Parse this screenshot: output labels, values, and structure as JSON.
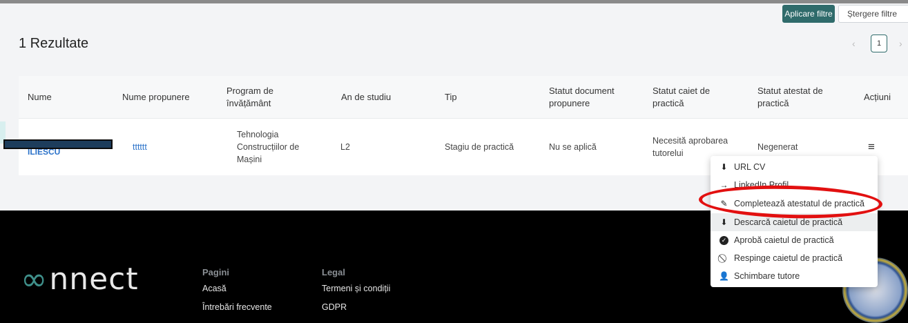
{
  "toolbar": {
    "apply_label": "Aplicare filtre",
    "clear_label": "Ștergere filtre"
  },
  "results": {
    "label": "1 Rezultate"
  },
  "pagination": {
    "prev": "‹",
    "current": "1",
    "next": "›"
  },
  "table": {
    "headers": [
      "Nume",
      "Nume propunere",
      "Program de învățământ",
      "An de studiu",
      "Tip",
      "Statut document propunere",
      "Statut caiet de practică",
      "Statut atestat de practică",
      "Acțiuni"
    ],
    "row": {
      "name_last": "ILIESCU",
      "proposal": "tttttt",
      "program": "Tehnologia Construcțiilor de Mașini",
      "year": "L2",
      "type": "Stagiu de practică",
      "doc_status": "Nu se aplică",
      "notebook_status": "Necesită aprobarea tutorelui",
      "certificate_status": "Negenerat",
      "actions_icon": "≡"
    }
  },
  "dropdown": {
    "items": [
      {
        "label": "URL CV",
        "icon": "download-icon"
      },
      {
        "label": "LinkedIn Profil",
        "icon": "arrow-right-icon"
      },
      {
        "label": "Completează atestatul de practică",
        "icon": "pencil-icon"
      },
      {
        "label": "Descarcă caietul de practică",
        "icon": "download-icon"
      },
      {
        "label": "Aprobă caietul de practică",
        "icon": "check-circle-icon"
      },
      {
        "label": "Respinge caietul de practică",
        "icon": "ban-icon"
      },
      {
        "label": "Schimbare tutore",
        "icon": "user-swap-icon"
      }
    ]
  },
  "footer": {
    "logo_text": "nnect",
    "col1": {
      "heading": "Pagini",
      "links": [
        "Acasă",
        "Întrebări frecvente"
      ]
    },
    "col2": {
      "heading": "Legal",
      "links": [
        "Termeni și condiții",
        "GDPR"
      ]
    }
  },
  "colors": {
    "accent": "#2f6b6b",
    "link": "#2b72c9",
    "annotation": "#e21010"
  }
}
